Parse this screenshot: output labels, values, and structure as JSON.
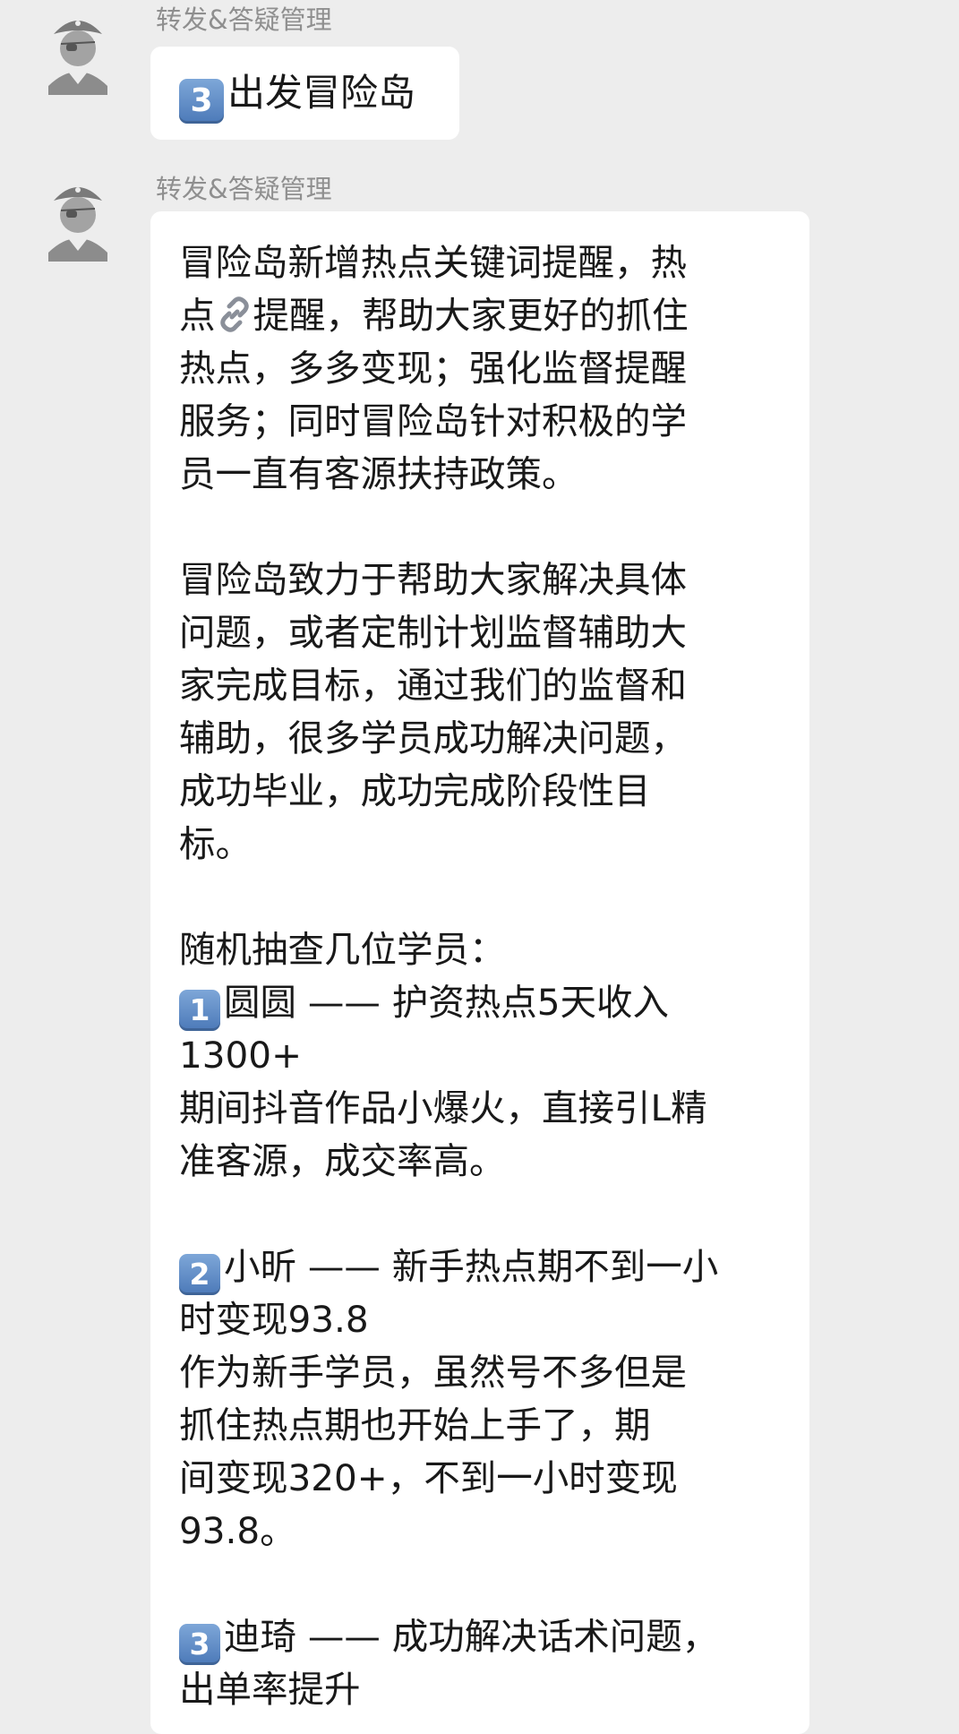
{
  "messages": [
    {
      "sender": "转发&答疑管理",
      "lines": [
        [
          {
            "key": "3"
          },
          {
            "t": "出发冒险岛"
          }
        ]
      ]
    },
    {
      "sender": "转发&答疑管理",
      "lines": [
        [
          {
            "t": "冒险岛新增热点关键词提醒，热"
          }
        ],
        [
          {
            "t": "点"
          },
          {
            "icon": "link-icon"
          },
          {
            "t": "提醒，帮助大家更好的抓住"
          }
        ],
        [
          {
            "t": "热点，多多变现；强化监督提醒"
          }
        ],
        [
          {
            "t": "服务；同时冒险岛针对积极的学"
          }
        ],
        [
          {
            "t": "员一直有客源扶持政策。"
          }
        ],
        [],
        [
          {
            "t": "冒险岛致力于帮助大家解决具体"
          }
        ],
        [
          {
            "t": "问题，或者定制计划监督辅助大"
          }
        ],
        [
          {
            "t": "家完成目标，通过我们的监督和"
          }
        ],
        [
          {
            "t": "辅助，很多学员成功解决问题，"
          }
        ],
        [
          {
            "t": "成功毕业，成功完成阶段性目"
          }
        ],
        [
          {
            "t": "标。"
          }
        ],
        [],
        [
          {
            "t": "随机抽查几位学员："
          }
        ],
        [
          {
            "key": "1"
          },
          {
            "t": "圆圆 —— 护资热点5天收入"
          }
        ],
        [
          {
            "t": "1300+"
          }
        ],
        [
          {
            "t": "期间抖音作品小爆火，直接引L精"
          }
        ],
        [
          {
            "t": "准客源，成交率高。"
          }
        ],
        [],
        [
          {
            "key": "2"
          },
          {
            "t": "小昕 —— 新手热点期不到一小"
          }
        ],
        [
          {
            "t": "时变现93.8"
          }
        ],
        [
          {
            "t": "作为新手学员，虽然号不多但是"
          }
        ],
        [
          {
            "t": "抓住热点期也开始上手了，期"
          }
        ],
        [
          {
            "t": "间变现320+，不到一小时变现"
          }
        ],
        [
          {
            "t": "93.8。"
          }
        ],
        [],
        [
          {
            "key": "3"
          },
          {
            "t": "迪琦 —— 成功解决话术问题，"
          }
        ],
        [
          {
            "t": "出单率提升"
          }
        ]
      ]
    }
  ]
}
